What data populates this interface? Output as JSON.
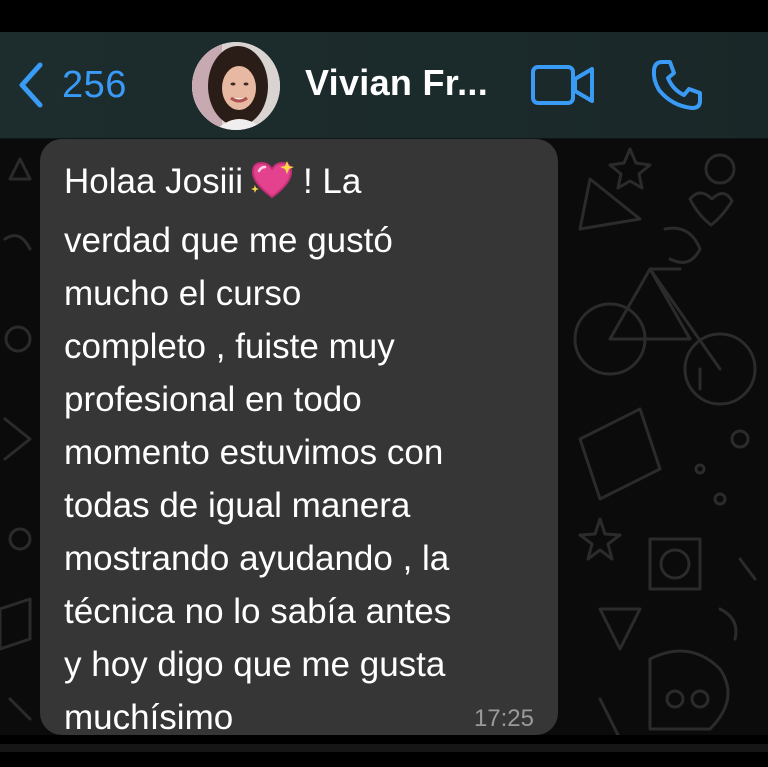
{
  "header": {
    "back_count": "256",
    "contact_name": "Vivian Fr...",
    "accent_color": "#3a9bf6"
  },
  "message": {
    "lines_before_emoji": "Holaa Josiii",
    "emoji_icon": "sparkling-heart-icon",
    "lines_after_emoji": "! La",
    "lines": [
      "verdad que me gustó",
      "mucho el curso",
      "completo , fuiste muy",
      "profesional en todo",
      "momento estuvimos con",
      "todas de igual manera",
      "mostrando ayudando , la",
      "técnica no lo sabía antes",
      "y hoy digo que me gusta",
      "muchísimo"
    ],
    "time": "17:25",
    "bubble_color": "#363636"
  }
}
